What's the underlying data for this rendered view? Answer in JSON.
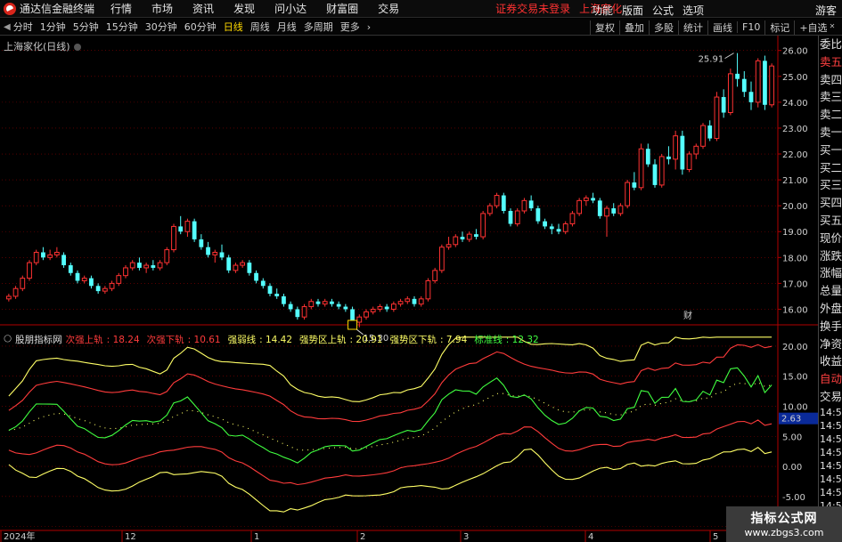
{
  "app": {
    "name": "通达信金融终端",
    "guest": "游客"
  },
  "menus": [
    "行情",
    "市场",
    "资讯",
    "发现",
    "问小达",
    "财富圈",
    "交易"
  ],
  "alert": {
    "warn": "证券交易未登录",
    "stock": "上海家化"
  },
  "right_menus": [
    "功能",
    "版面",
    "公式",
    "选项"
  ],
  "periods": [
    "分时",
    "1分钟",
    "5分钟",
    "15分钟",
    "30分钟",
    "60分钟",
    "日线",
    "周线",
    "月线",
    "多周期",
    "更多"
  ],
  "active_period": "日线",
  "right_tools": [
    "复权",
    "叠加",
    "多股",
    "统计",
    "画线",
    "F10",
    "标记",
    "+自选"
  ],
  "stock_title": "上海家化(日线)",
  "price_axis": {
    "labels": [
      "26.00",
      "25.00",
      "24.00",
      "23.00",
      "22.00",
      "21.00",
      "20.00",
      "19.00",
      "18.00",
      "17.00",
      "16.00"
    ],
    "values": [
      26,
      25,
      24,
      23,
      22,
      21,
      20,
      19,
      18,
      17,
      16
    ]
  },
  "annotations": {
    "high": "25.91",
    "low": "15.30",
    "finance_mark": "财"
  },
  "indicator": {
    "name": "股朋指标网",
    "legend": [
      {
        "label": "次强上轨",
        "value": "18.24",
        "color": "#ff3b3b"
      },
      {
        "label": "次强下轨",
        "value": "10.61",
        "color": "#ff3b3b"
      },
      {
        "label": "强弱线",
        "value": "14.42",
        "color": "#ffff66"
      },
      {
        "label": "强势区上轨",
        "value": "20.91",
        "color": "#ffff66"
      },
      {
        "label": "强势区下轨",
        "value": "7.94",
        "color": "#ffff66"
      },
      {
        "label": "标准线",
        "value": "12.32",
        "color": "#40ff40"
      }
    ],
    "axis_labels": [
      "20.00",
      "15.00",
      "10.00",
      "5.00",
      "0.00",
      "-5.00",
      "-10.0"
    ],
    "axis_values": [
      20,
      15,
      10,
      5,
      0,
      -5,
      -10
    ],
    "current_value": "2.63"
  },
  "x_axis": {
    "labels": [
      "2024年",
      "12",
      "1",
      "2",
      "3",
      "4",
      "5"
    ]
  },
  "right_panel": [
    "委比",
    "卖五",
    "卖四",
    "卖三",
    "卖二",
    "卖一",
    "买一",
    "买二",
    "买三",
    "买四",
    "买五",
    "现价",
    "涨跌",
    "涨幅",
    "总量",
    "外盘",
    "换手",
    "净资",
    "收益",
    "自动",
    "交易"
  ],
  "tick_times": [
    "14:56",
    "14:56",
    "14:56",
    "14:56",
    "14:56",
    "14:56",
    "14:56",
    "14:56",
    "14:56"
  ],
  "watermark": {
    "title": "指标公式网",
    "url": "www.zbgs3.com"
  },
  "colors": {
    "up": "#ff3232",
    "down": "#54ffff",
    "bg": "#000000",
    "grid": "#8b0000"
  },
  "chart_data": {
    "type": "candlestick",
    "x_labels": [
      "2024年",
      "12",
      "1",
      "2",
      "3",
      "4",
      "5"
    ],
    "ylim": [
      15.5,
      26.3
    ],
    "ohlc": [
      [
        16.4,
        16.6,
        16.3,
        16.5
      ],
      [
        16.5,
        16.9,
        16.4,
        16.8
      ],
      [
        16.8,
        17.3,
        16.7,
        17.2
      ],
      [
        17.2,
        17.9,
        17.1,
        17.8
      ],
      [
        17.8,
        18.3,
        17.7,
        18.2
      ],
      [
        18.2,
        18.4,
        17.9,
        18.0
      ],
      [
        18.0,
        18.3,
        17.9,
        18.1
      ],
      [
        18.1,
        18.4,
        18.0,
        18.2
      ],
      [
        18.1,
        18.2,
        17.6,
        17.7
      ],
      [
        17.7,
        17.8,
        17.3,
        17.4
      ],
      [
        17.4,
        17.5,
        17.0,
        17.1
      ],
      [
        17.1,
        17.3,
        17.0,
        17.2
      ],
      [
        17.2,
        17.3,
        16.8,
        16.9
      ],
      [
        16.9,
        17.0,
        16.6,
        16.7
      ],
      [
        16.7,
        16.9,
        16.6,
        16.8
      ],
      [
        16.8,
        17.1,
        16.7,
        17.0
      ],
      [
        17.0,
        17.4,
        16.9,
        17.3
      ],
      [
        17.3,
        17.7,
        17.2,
        17.6
      ],
      [
        17.6,
        17.9,
        17.5,
        17.8
      ],
      [
        17.8,
        18.0,
        17.5,
        17.6
      ],
      [
        17.6,
        17.8,
        17.4,
        17.7
      ],
      [
        17.7,
        17.9,
        17.5,
        17.6
      ],
      [
        17.6,
        17.9,
        17.5,
        17.8
      ],
      [
        17.8,
        18.4,
        17.7,
        18.3
      ],
      [
        18.3,
        19.3,
        18.2,
        19.2
      ],
      [
        19.2,
        19.6,
        18.9,
        19.0
      ],
      [
        19.0,
        19.5,
        18.8,
        19.4
      ],
      [
        19.4,
        19.5,
        18.6,
        18.7
      ],
      [
        18.7,
        18.9,
        18.3,
        18.4
      ],
      [
        18.4,
        18.6,
        18.0,
        18.1
      ],
      [
        18.1,
        18.3,
        17.8,
        18.2
      ],
      [
        18.2,
        18.5,
        17.9,
        18.0
      ],
      [
        18.0,
        18.1,
        17.4,
        17.5
      ],
      [
        17.5,
        17.8,
        17.4,
        17.7
      ],
      [
        17.7,
        17.9,
        17.6,
        17.8
      ],
      [
        17.8,
        17.9,
        17.3,
        17.4
      ],
      [
        17.4,
        17.5,
        17.0,
        17.1
      ],
      [
        17.1,
        17.2,
        16.8,
        16.9
      ],
      [
        16.9,
        17.0,
        16.5,
        16.6
      ],
      [
        16.6,
        16.8,
        16.4,
        16.5
      ],
      [
        16.5,
        16.6,
        16.1,
        16.2
      ],
      [
        16.2,
        16.3,
        15.9,
        16.0
      ],
      [
        16.0,
        16.1,
        15.6,
        15.7
      ],
      [
        15.7,
        16.2,
        15.6,
        16.1
      ],
      [
        16.1,
        16.4,
        16.0,
        16.3
      ],
      [
        16.3,
        16.4,
        16.1,
        16.2
      ],
      [
        16.2,
        16.4,
        16.1,
        16.3
      ],
      [
        16.3,
        16.4,
        16.1,
        16.2
      ],
      [
        16.2,
        16.3,
        16.0,
        16.1
      ],
      [
        16.1,
        16.2,
        15.9,
        16.0
      ],
      [
        16.0,
        16.1,
        15.3,
        15.5
      ],
      [
        15.5,
        15.8,
        15.3,
        15.7
      ],
      [
        15.7,
        16.0,
        15.6,
        15.9
      ],
      [
        15.9,
        16.1,
        15.8,
        16.0
      ],
      [
        16.0,
        16.2,
        15.9,
        16.1
      ],
      [
        16.1,
        16.2,
        15.9,
        16.0
      ],
      [
        16.0,
        16.3,
        15.9,
        16.2
      ],
      [
        16.2,
        16.4,
        16.1,
        16.3
      ],
      [
        16.3,
        16.5,
        16.2,
        16.4
      ],
      [
        16.4,
        16.5,
        16.1,
        16.2
      ],
      [
        16.2,
        16.5,
        16.1,
        16.4
      ],
      [
        16.4,
        17.2,
        16.3,
        17.1
      ],
      [
        17.1,
        17.6,
        17.0,
        17.5
      ],
      [
        17.5,
        18.5,
        17.4,
        18.4
      ],
      [
        18.4,
        18.8,
        18.3,
        18.5
      ],
      [
        18.5,
        18.9,
        18.4,
        18.8
      ],
      [
        18.8,
        19.0,
        18.6,
        18.7
      ],
      [
        18.7,
        19.0,
        18.6,
        18.9
      ],
      [
        18.9,
        19.1,
        18.7,
        18.8
      ],
      [
        18.8,
        19.8,
        18.7,
        19.7
      ],
      [
        19.7,
        20.1,
        19.6,
        20.0
      ],
      [
        20.0,
        20.5,
        19.9,
        20.4
      ],
      [
        20.4,
        20.5,
        19.7,
        19.8
      ],
      [
        19.8,
        19.9,
        19.2,
        19.3
      ],
      [
        19.3,
        19.9,
        19.2,
        19.8
      ],
      [
        19.8,
        20.3,
        19.7,
        20.2
      ],
      [
        20.2,
        20.4,
        19.8,
        19.9
      ],
      [
        19.9,
        20.0,
        19.3,
        19.4
      ],
      [
        19.4,
        19.5,
        19.1,
        19.2
      ],
      [
        19.2,
        19.3,
        18.9,
        19.1
      ],
      [
        19.1,
        19.3,
        18.9,
        19.0
      ],
      [
        19.0,
        19.4,
        18.9,
        19.3
      ],
      [
        19.3,
        19.8,
        19.2,
        19.7
      ],
      [
        19.7,
        20.3,
        19.6,
        20.2
      ],
      [
        20.2,
        20.4,
        20.0,
        20.3
      ],
      [
        20.3,
        20.5,
        20.1,
        20.2
      ],
      [
        20.2,
        20.3,
        19.5,
        19.6
      ],
      [
        19.6,
        20.0,
        18.8,
        19.9
      ],
      [
        19.9,
        20.1,
        19.6,
        19.7
      ],
      [
        19.7,
        20.1,
        19.6,
        20.0
      ],
      [
        20.0,
        21.0,
        19.9,
        20.9
      ],
      [
        20.9,
        21.3,
        20.6,
        20.7
      ],
      [
        20.7,
        22.4,
        20.6,
        22.2
      ],
      [
        22.2,
        22.4,
        21.5,
        21.6
      ],
      [
        21.6,
        21.8,
        20.7,
        20.8
      ],
      [
        20.8,
        22.0,
        20.7,
        21.9
      ],
      [
        21.9,
        22.3,
        21.6,
        21.8
      ],
      [
        21.8,
        22.9,
        21.4,
        22.7
      ],
      [
        22.7,
        22.9,
        21.2,
        21.4
      ],
      [
        21.4,
        22.1,
        21.3,
        22.0
      ],
      [
        22.0,
        22.4,
        21.8,
        22.3
      ],
      [
        22.3,
        23.2,
        22.2,
        23.1
      ],
      [
        23.1,
        23.3,
        22.5,
        22.6
      ],
      [
        22.6,
        24.4,
        22.5,
        24.2
      ],
      [
        24.2,
        24.5,
        23.4,
        23.6
      ],
      [
        23.6,
        25.3,
        23.5,
        25.1
      ],
      [
        25.1,
        25.9,
        24.6,
        24.9
      ],
      [
        24.9,
        25.2,
        24.2,
        24.4
      ],
      [
        24.4,
        24.8,
        23.7,
        24.0
      ],
      [
        24.0,
        25.7,
        23.8,
        25.6
      ],
      [
        25.6,
        25.8,
        23.7,
        23.9
      ],
      [
        23.9,
        25.5,
        23.8,
        25.4
      ]
    ]
  }
}
